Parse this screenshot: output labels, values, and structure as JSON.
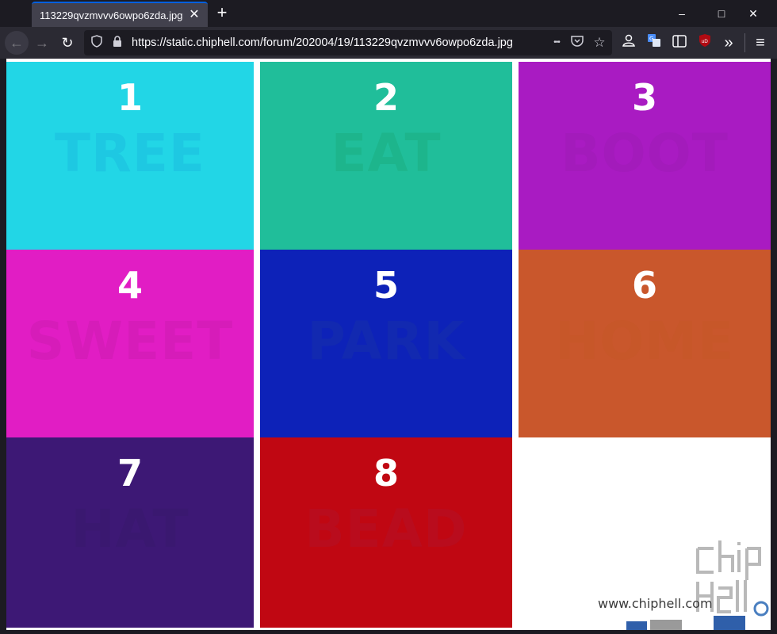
{
  "tab": {
    "title": "113229qvzmvvv6owpo6zda.jpg",
    "close_icon": "close-icon"
  },
  "toolbar": {
    "new_tab_icon": "+",
    "url": "https://static.chiphell.com/forum/202004/19/113229qvzmvvv6owpo6zda.jpg",
    "more_label": "•••"
  },
  "window": {
    "minimize": "–",
    "maximize": "□",
    "close": "✕"
  },
  "cells": [
    {
      "number": "1",
      "word": "TREE",
      "bg": "#22d6e6",
      "word_color": "#1ec8e2"
    },
    {
      "number": "2",
      "word": "EAT",
      "bg": "#20be9a",
      "word_color": "#1db58c"
    },
    {
      "number": "3",
      "word": "BOOT",
      "bg": "#a91bc2",
      "word_color": "#a31bbb"
    },
    {
      "number": "4",
      "word": "SWEET",
      "bg": "#e11dc4",
      "word_color": "#d61cb9"
    },
    {
      "number": "5",
      "word": "PARK",
      "bg": "#0d22b8",
      "word_color": "#1229b0"
    },
    {
      "number": "6",
      "word": "HOME",
      "bg": "#c9572c",
      "word_color": "#c75729"
    },
    {
      "number": "7",
      "word": "HAT",
      "bg": "#3d1875",
      "word_color": "#3a1870"
    },
    {
      "number": "8",
      "word": "BEAD",
      "bg": "#c00712",
      "word_color": "#b90c1d"
    }
  ],
  "watermark": {
    "text": "www.chiphell.com",
    "logo": "chip hell"
  }
}
